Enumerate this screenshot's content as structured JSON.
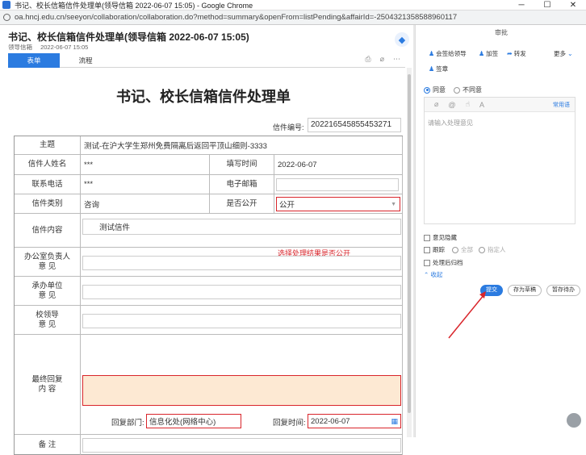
{
  "window": {
    "title": "书记、校长信箱信件处理单(领导信箱 2022-06-07 15:05) - Google Chrome",
    "url": "oa.hncj.edu.cn/seeyon/collaboration/collaboration.do?method=summary&openFrom=listPending&affairId=-2504321358588960117"
  },
  "doc": {
    "title": "书记、校长信箱信件处理单(领导信箱 2022-06-07 15:05)",
    "source": "领导信箱",
    "date": "2022-06-07 15:05",
    "tabs": [
      "表单",
      "流程"
    ]
  },
  "form": {
    "title": "书记、校长信箱信件处理单",
    "number_label": "信件编号:",
    "number_value": "202216545855453271",
    "rows": {
      "subject_label": "主题",
      "subject_value": "测试-在沪大学生郑州免费隔离后返回平顶山细则-3333",
      "name_label": "信件人姓名",
      "name_value": "***",
      "fill_time_label": "填写时间",
      "fill_time_value": "2022-06-07",
      "phone_label": "联系电话",
      "phone_value": "***",
      "email_label": "电子邮箱",
      "category_label": "信件类别",
      "category_value": "咨询",
      "public_label": "是否公开",
      "public_value": "公开",
      "public_hint": "选择处理结果是否公开",
      "content_label": "信件内容",
      "content_value": "测试信件",
      "office_label_1": "办公室负责人",
      "office_label_2": "意 见",
      "unit_label_1": "承办单位",
      "unit_label_2": "意 见",
      "leader_label_1": "校领导",
      "leader_label_2": "意 见",
      "final_label_1": "最终回复",
      "final_label_2": "内 容",
      "reply_dept_label": "回复部门:",
      "reply_dept_value": "信息化处(网络中心)",
      "reply_time_label": "回复时间:",
      "reply_time_value": "2022-06-07",
      "remark_label": "备 注"
    }
  },
  "panel": {
    "header": "审批",
    "actions": [
      "会签给领导",
      "加签",
      "转发",
      "更多",
      "签章"
    ],
    "agree": "同意",
    "disagree": "不同意",
    "phrases": "常用语",
    "placeholder": "请输入处理意见",
    "hide_opinion": "意见隐藏",
    "track": "跟踪",
    "track_all": "全部",
    "track_specified": "指定人",
    "archive": "处理后归档",
    "collapse": "收起",
    "submit": "提交",
    "save_draft": "存为草稿",
    "hold": "暂存待办"
  }
}
